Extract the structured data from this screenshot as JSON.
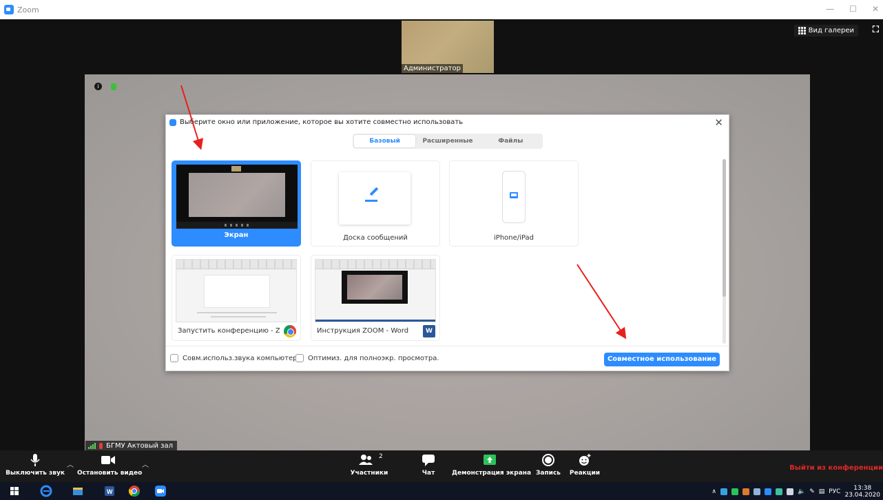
{
  "window": {
    "title": "Zoom",
    "controls": [
      "—",
      "☐",
      "✕"
    ]
  },
  "meeting": {
    "thumbnail_name": "Администратор",
    "gallery_label": "Вид галереи",
    "participant_name": "БГМУ Актовый зал"
  },
  "dialog": {
    "title": "Выберите окно или приложение, которое вы хотите совместно использовать",
    "tabs": [
      {
        "label": "Базовый",
        "active": true
      },
      {
        "label": "Расширенные",
        "active": false
      },
      {
        "label": "Файлы",
        "active": false
      }
    ],
    "tiles": [
      {
        "label": "Экран",
        "selected": true
      },
      {
        "label": "Доска сообщений",
        "selected": false
      },
      {
        "label": "iPhone/iPad",
        "selected": false
      },
      {
        "label": "Запустить конференцию - Zoo...",
        "app": "chrome-icon"
      },
      {
        "label": "Инструкция ZOOM - Word",
        "app": "word-icon"
      }
    ],
    "options": [
      {
        "label": "Совм.использ.звука компьютера",
        "checked": false
      },
      {
        "label": "Оптимиз. для полноэкр. просмотра.",
        "checked": false
      }
    ],
    "share_button": "Совместное использование"
  },
  "toolbar": {
    "mute": "Выключить звук",
    "video": "Остановить видео",
    "participants": "Участники",
    "participants_count": "2",
    "chat": "Чат",
    "share_screen": "Демонстрация экрана",
    "record": "Запись",
    "reactions": "Реакции",
    "leave": "Выйти из конференции"
  },
  "taskbar": {
    "lang": "РУС",
    "time": "13:38",
    "date": "23.04.2020"
  },
  "colors": {
    "accent": "#2d8cff",
    "leave": "#e02828",
    "arrow": "#e8201c"
  }
}
